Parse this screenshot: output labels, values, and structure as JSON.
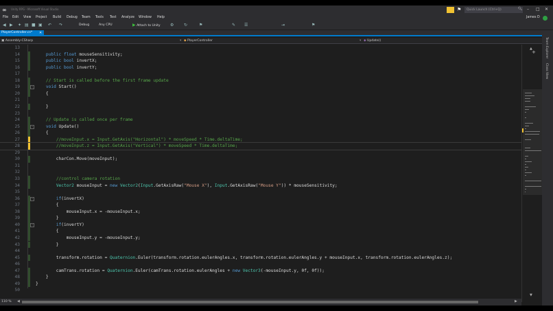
{
  "window": {
    "title": "Unity RPG - Microsoft Visual Studio",
    "quick_launch_placeholder": "Quick Launch (Ctrl+Q)",
    "user_name": "James D",
    "user_initials": "JD"
  },
  "menu": [
    "File",
    "Edit",
    "View",
    "Project",
    "Build",
    "Debug",
    "Team",
    "Tools",
    "Test",
    "Analyze",
    "Window",
    "Help"
  ],
  "toolbar": {
    "configuration": "Debug",
    "platform": "Any CPU",
    "attach_label": "Attach to Unity"
  },
  "tabs": [
    {
      "label": "PlayerController.cs*"
    }
  ],
  "navbar": {
    "project": "Assembly-CSharp",
    "type": "PlayerController",
    "member": "Update()"
  },
  "editor": {
    "lines": [
      {
        "n": "13",
        "text": ""
      },
      {
        "n": "14",
        "text": "    public float mouseSensitivity;"
      },
      {
        "n": "15",
        "text": "    public bool invertX;"
      },
      {
        "n": "16",
        "text": "    public bool invertY;"
      },
      {
        "n": "17",
        "text": ""
      },
      {
        "n": "18",
        "text": "    // Start is called before the first frame update"
      },
      {
        "n": "19",
        "text": "    void Start()"
      },
      {
        "n": "20",
        "text": "    {"
      },
      {
        "n": "21",
        "text": ""
      },
      {
        "n": "22",
        "text": "    }"
      },
      {
        "n": "23",
        "text": ""
      },
      {
        "n": "24",
        "text": "    // Update is called once per frame"
      },
      {
        "n": "25",
        "text": "    void Update()"
      },
      {
        "n": "26",
        "text": "    {"
      },
      {
        "n": "27",
        "text": "        //moveInput.x = Input.GetAxis(\"Horizontal\") * moveSpeed * Time.deltaTime;"
      },
      {
        "n": "28",
        "text": "        //moveInput.z = Input.GetAxis(\"Vertical\") * moveSpeed * Time.deltaTime;"
      },
      {
        "n": "29",
        "text": ""
      },
      {
        "n": "30",
        "text": "        charCon.Move(moveInput);"
      },
      {
        "n": "31",
        "text": ""
      },
      {
        "n": "32",
        "text": ""
      },
      {
        "n": "33",
        "text": "        //control camera rotation"
      },
      {
        "n": "34",
        "text": "        Vector2 mouseInput = new Vector2(Input.GetAxisRaw(\"Mouse X\"), Input.GetAxisRaw(\"Mouse Y\")) * mouseSensitivity;"
      },
      {
        "n": "35",
        "text": ""
      },
      {
        "n": "36",
        "text": "        if(invertX)"
      },
      {
        "n": "37",
        "text": "        {"
      },
      {
        "n": "38",
        "text": "            mouseInput.x = -mouseInput.x;"
      },
      {
        "n": "39",
        "text": "        }"
      },
      {
        "n": "40",
        "text": "        if(invertY)"
      },
      {
        "n": "41",
        "text": "        {"
      },
      {
        "n": "42",
        "text": "            mouseInput.y = -mouseInput.y;"
      },
      {
        "n": "43",
        "text": "        }"
      },
      {
        "n": "44",
        "text": ""
      },
      {
        "n": "45",
        "text": "        transform.rotation = Quaternion.Euler(transform.rotation.eulerAngles.x, transform.rotation.eulerAngles.y + mouseInput.x, transform.rotation.eulerAngles.z);"
      },
      {
        "n": "46",
        "text": ""
      },
      {
        "n": "47",
        "text": "        camTrans.rotation = Quaternion.Euler(camTrans.rotation.eulerAngles + new Vector3(-mouseInput.y, 0f, 0f));"
      },
      {
        "n": "48",
        "text": "    }"
      },
      {
        "n": "49",
        "text": "}"
      },
      {
        "n": "50",
        "text": ""
      }
    ]
  },
  "status": {
    "zoom": "110 %"
  },
  "side_panels": [
    "Team Explorer",
    "Class View"
  ],
  "colors": {
    "accent": "#007acc",
    "keyword": "#569cd6",
    "comment": "#57a64a",
    "string": "#d69d85",
    "type": "#4ec9b0",
    "changed": "#f1c232"
  }
}
